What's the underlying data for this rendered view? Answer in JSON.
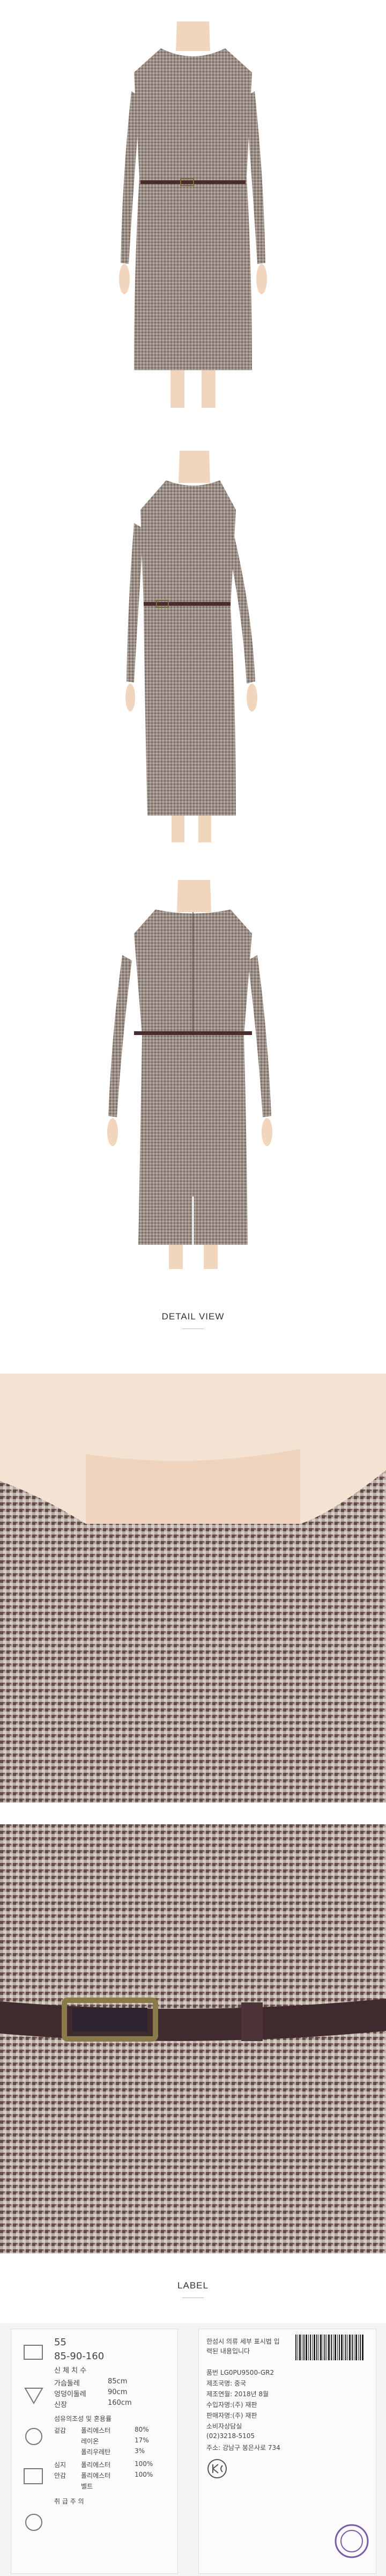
{
  "sections": {
    "detail_view": "DETAIL VIEW",
    "label": "LABEL"
  },
  "care_label": {
    "size": "55",
    "measure": "85-90-160",
    "size_heading": "신 체 치 수",
    "bust_label": "가슴둘레",
    "bust_value": "85cm",
    "hip_label": "엉덩이둘레",
    "hip_value": "90cm",
    "height_label": "신장",
    "height_value": "160cm",
    "fiber_heading": "섬유의조성 및 혼용률",
    "shell_label": "겉감",
    "fiber_1": "폴리에스터",
    "pct_1": "80%",
    "fiber_2": "레이온",
    "pct_2": "17%",
    "fiber_3": "폴리우레탄",
    "pct_3": "3%",
    "lining_label": "심지",
    "lining_fiber": "폴리에스터",
    "lining_pct": "100%",
    "binding_label": "안감",
    "binding_fiber": "폴리에스터",
    "binding_pct": "100%",
    "extra": "벨트",
    "care_heading": "취 급 주 의"
  },
  "product_tag": {
    "line1": "한섬시 의류 세부 표시법 입",
    "line2": "력된 내용입니다",
    "item_no": "품번 LG0PU9500-GR2",
    "origin": "제조국명: 중국",
    "date": "제조연월: 2018년 8월",
    "importer": "수입자명:(주) 재판",
    "seller": "판매자명:(주) 재판",
    "service": "소비자상담실",
    "phone": "(02)3218-5105",
    "address": "주소: 강남구 봉은사로 734"
  }
}
